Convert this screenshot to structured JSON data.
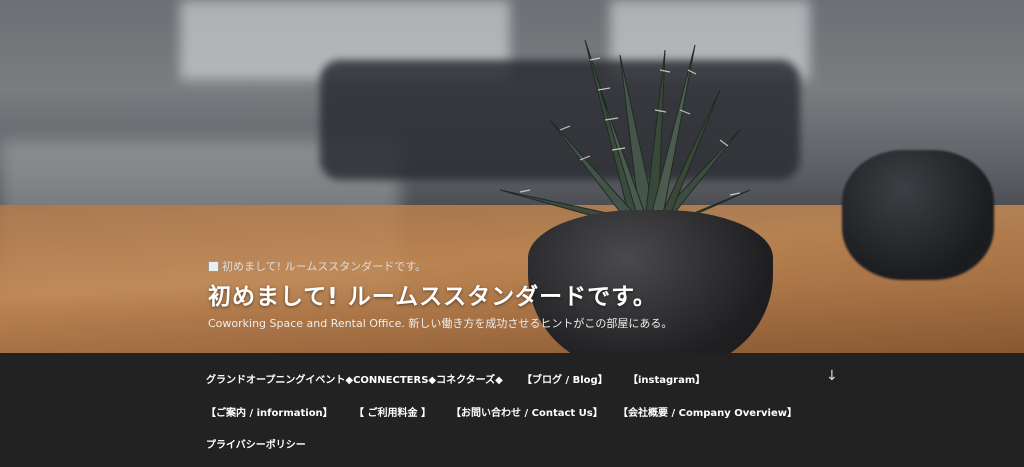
{
  "header": {
    "logo_alt": "初めまして! ルームススタンダードです。",
    "site_title": "初めまして! ルームススタンダードです。",
    "tagline": "Coworking Space and Rental Office. 新しい働き方を成功させるヒントがこの部屋にある。"
  },
  "nav": {
    "items": [
      {
        "label": "グランドオープニングイベント◆CONNECTERS◆コネクターズ◆"
      },
      {
        "label": "【ブログ / Blog】"
      },
      {
        "label": "【instagram】"
      },
      {
        "label": "【ご案内 / information】"
      },
      {
        "label": "【 ご利用料金 】"
      },
      {
        "label": "【お問い合わせ / Contact Us】"
      },
      {
        "label": "【会社概要 / Company Overview】"
      },
      {
        "label": "プライバシーポリシー"
      }
    ],
    "scroll_icon": "arrow-down-icon",
    "scroll_glyph": "↓"
  },
  "colors": {
    "nav_background": "#222222",
    "text": "#ffffff"
  }
}
